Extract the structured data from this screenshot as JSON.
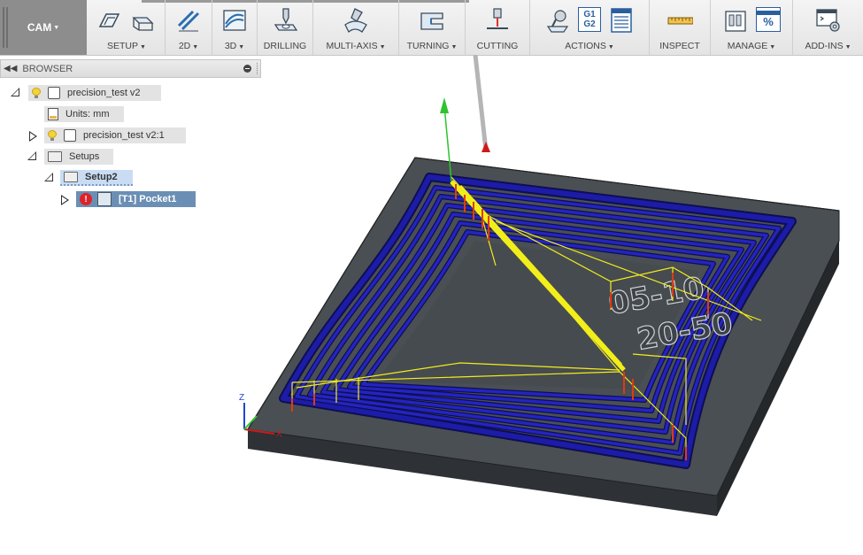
{
  "toolbar": {
    "workspace": "CAM",
    "groups": [
      {
        "label": "SETUP",
        "has_caret": true,
        "icons": [
          "setup-icon",
          "stock-icon"
        ]
      },
      {
        "label": "2D",
        "has_caret": true,
        "icons": [
          "2d-adaptive-icon"
        ]
      },
      {
        "label": "3D",
        "has_caret": true,
        "icons": [
          "3d-adaptive-icon"
        ]
      },
      {
        "label": "DRILLING",
        "has_caret": false,
        "icons": [
          "drill-icon"
        ]
      },
      {
        "label": "MULTI-AXIS",
        "has_caret": true,
        "icons": [
          "multi-axis-icon"
        ]
      },
      {
        "label": "TURNING",
        "has_caret": true,
        "icons": [
          "turning-icon"
        ]
      },
      {
        "label": "CUTTING",
        "has_caret": false,
        "icons": [
          "cutting-icon"
        ]
      },
      {
        "label": "ACTIONS",
        "has_caret": true,
        "icons": [
          "simulate-icon",
          "post-process-icon",
          "setup-sheet-icon"
        ],
        "post_text": "G1\nG2"
      },
      {
        "label": "INSPECT",
        "has_caret": false,
        "icons": [
          "measure-icon"
        ]
      },
      {
        "label": "MANAGE",
        "has_caret": true,
        "icons": [
          "tool-library-icon",
          "templates-icon"
        ],
        "percent_text": "%"
      },
      {
        "label": "ADD-INS",
        "has_caret": true,
        "icons": [
          "scripts-icon"
        ]
      }
    ]
  },
  "browser": {
    "title": "BROWSER",
    "items": [
      {
        "label": "precision_test v2",
        "type": "document"
      },
      {
        "label": "Units: mm",
        "type": "units"
      },
      {
        "label": "precision_test v2:1",
        "type": "component"
      },
      {
        "label": "Setups",
        "type": "setups-folder"
      },
      {
        "label": "Setup2",
        "type": "setup"
      },
      {
        "label": "[T1] Pocket1",
        "type": "operation"
      }
    ]
  },
  "viewport": {
    "engraved_text_line1": "05-10",
    "engraved_text_line2": "20-50",
    "axis_labels": {
      "z": "Z",
      "x": "X"
    },
    "colors": {
      "stock": "#4a4f54",
      "stock_side": "#2e3236",
      "toolpath_cut": "#1c1ca8",
      "toolpath_rapid": "#f2ee1a",
      "plunge": "#e03a10",
      "axis_green": "#2ec42e",
      "axis_red": "#d01818",
      "axis_blue": "#2244cc",
      "selection": "#c9dcf3",
      "operation_selected": "#6b8fb4"
    }
  }
}
